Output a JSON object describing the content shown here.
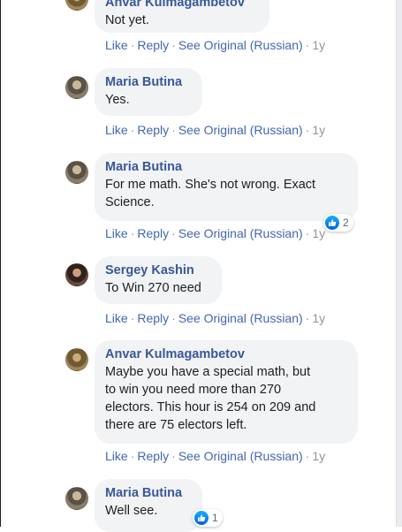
{
  "action_labels": {
    "like": "Like",
    "reply": "Reply",
    "see_original": "See Original (Russian)",
    "separator": "·"
  },
  "comments": [
    {
      "author": "Anvar Kulmagambetov",
      "text": [
        "Not yet."
      ],
      "time": "1y",
      "avatar_icon": "profile-photo-anvar"
    },
    {
      "author": "Maria Butina",
      "text": [
        "Yes."
      ],
      "time": "1y",
      "avatar_icon": "profile-photo-maria"
    },
    {
      "author": "Maria Butina",
      "text": [
        "For me math. She's not wrong. Exact",
        "Science."
      ],
      "time": "1y",
      "reaction_count": "2",
      "avatar_icon": "profile-photo-maria"
    },
    {
      "author": "Sergey Kashin",
      "text": [
        "To Win 270 need"
      ],
      "time": "1y",
      "avatar_icon": "profile-photo-sergey"
    },
    {
      "author": "Anvar Kulmagambetov",
      "text": [
        "Maybe you have a special math, but",
        "to win you need more than 270",
        "electors. This hour is 254 on 209 and",
        "there are 75 electors left."
      ],
      "time": "1y",
      "avatar_icon": "profile-photo-anvar"
    },
    {
      "author": "Maria Butina",
      "text": [
        "Well see."
      ],
      "reaction_count": "1",
      "avatar_icon": "profile-photo-maria"
    }
  ],
  "colors": {
    "author_link": "#385898",
    "action_link": "#4267b2",
    "bubble": "#f2f3f5",
    "muted": "#90949c",
    "like_blue": "#1877f2"
  }
}
